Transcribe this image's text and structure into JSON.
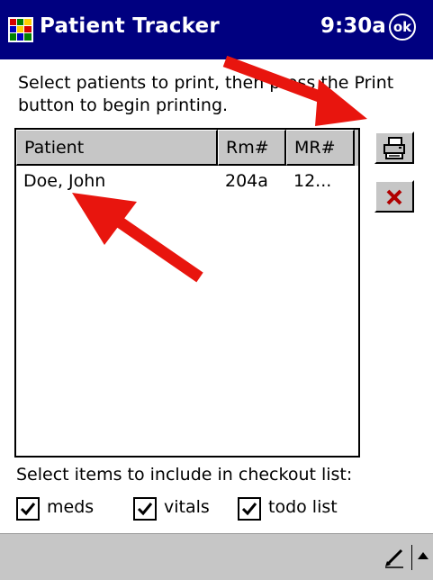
{
  "titlebar": {
    "app_title": "Patient Tracker",
    "clock": "9:30a",
    "ok_label": "ok",
    "icon": "app-grid-icon"
  },
  "instructions": "Select patients to print, then press the Print button to begin printing.",
  "patient_list": {
    "columns": [
      "Patient",
      "Rm#",
      "MR#"
    ],
    "rows": [
      {
        "patient": "Doe, John",
        "room": "204a",
        "mr": "12..."
      }
    ]
  },
  "side_buttons": {
    "print_icon": "printer-icon",
    "delete_icon": "delete-x-icon"
  },
  "checkout": {
    "label": "Select items to include in checkout list:",
    "items": [
      {
        "label": "meds",
        "checked": true
      },
      {
        "label": "vitals",
        "checked": true
      },
      {
        "label": "todo list",
        "checked": true
      }
    ]
  },
  "bottombar": {
    "pen_icon": "pen-input-icon",
    "sip_icon": "up-arrow-icon"
  },
  "colors": {
    "titlebar": "#000080",
    "chrome": "#c6c6c6",
    "arrow_annotation": "#e8150e"
  }
}
